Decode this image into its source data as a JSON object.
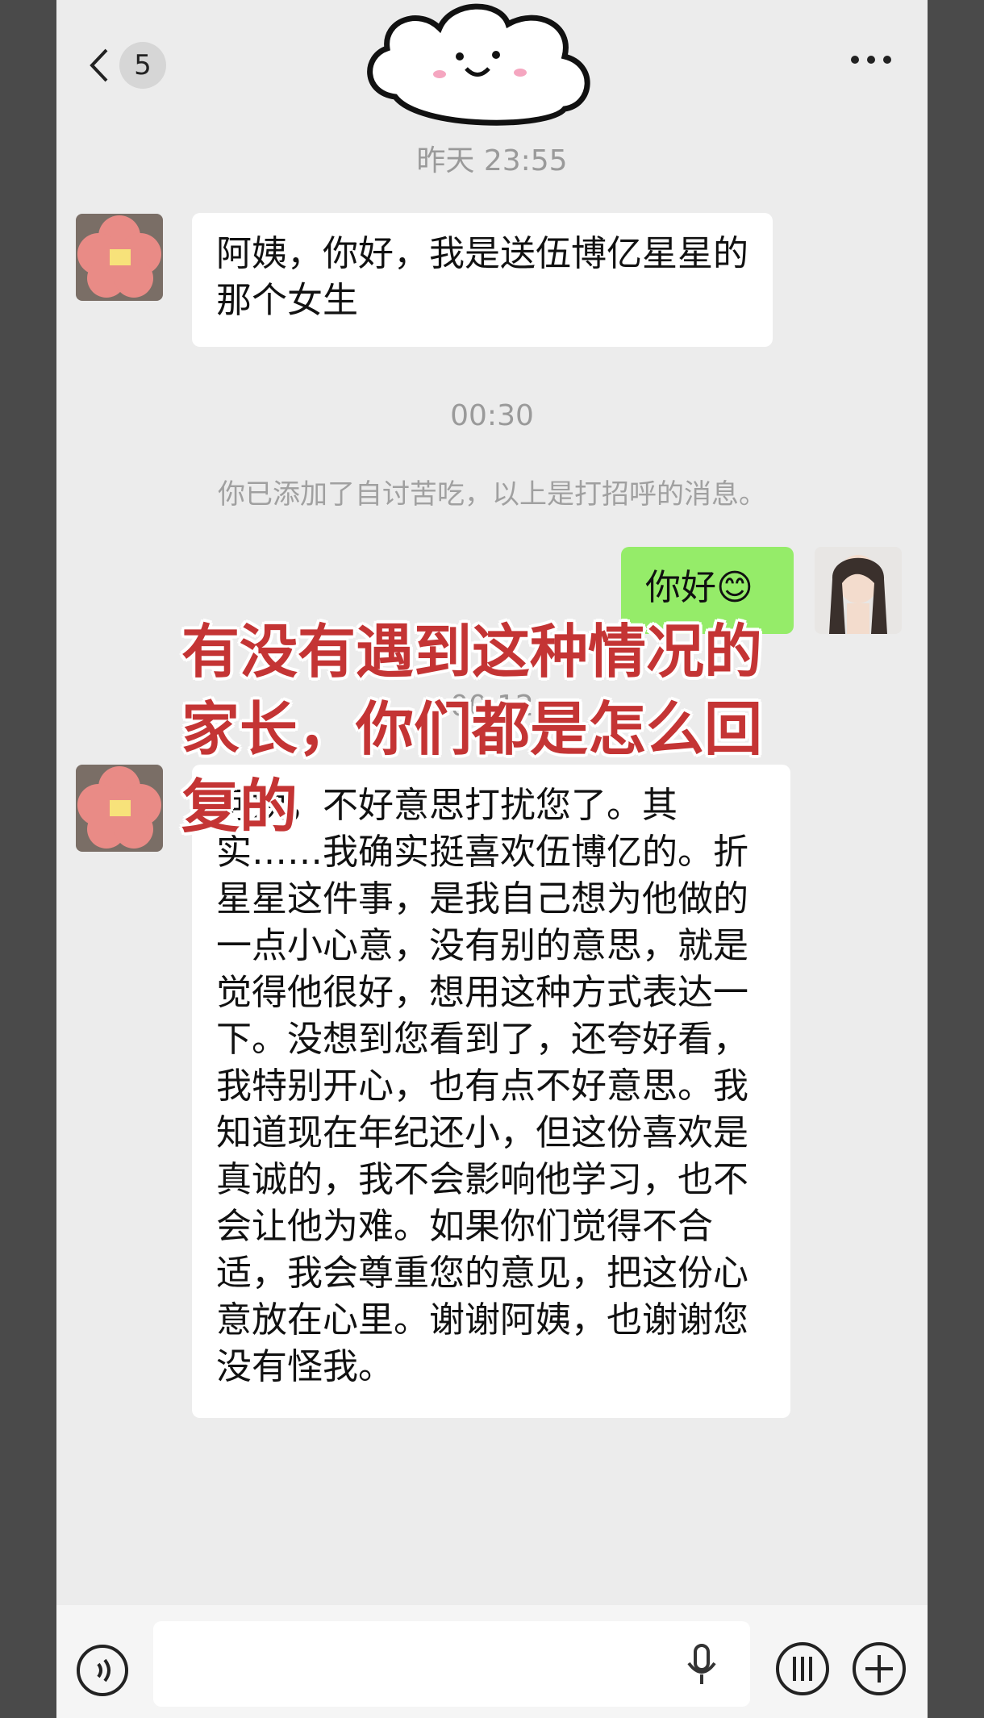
{
  "header": {
    "back_icon": "chevron-left-icon",
    "unread_count": "5",
    "more_icon": "more-dots-icon"
  },
  "messages": {
    "time_1": "昨天 23:55",
    "msg_1": "阿姨，你好，我是送伍博亿星星的那个女生",
    "time_2": "00:30",
    "system_note": "你已添加了自讨苦吃，以上是打招呼的消息。",
    "msg_2": "你好😊",
    "time_3": "00:12",
    "msg_3": "阿姨，不好意思打扰您了。其实……我确实挺喜欢伍博亿的。折星星这件事，是我自己想为他做的一点小心意，没有别的意思，就是觉得他很好，想用这种方式表达一下。没想到您看到了，还夸好看，我特别开心，也有点不好意思。我知道现在年纪还小，但这份喜欢是真诚的，我不会影响他学习，也不会让他为难。如果你们觉得不合适，我会尊重您的意见，把这份心意放在心里。谢谢阿姨，也谢谢您没有怪我。"
  },
  "overlay_text": "有没有遇到这种情况的家长，你们都是怎么回复的",
  "input_bar": {
    "voice_icon": "voice-toggle-icon",
    "mic_icon": "microphone-icon",
    "emoji_icon": "emoji-icon",
    "plus_icon": "plus-icon"
  },
  "colors": {
    "background": "#ececec",
    "bubble_incoming": "#ffffff",
    "bubble_outgoing": "#95ec69",
    "overlay_text": "#c43434"
  }
}
